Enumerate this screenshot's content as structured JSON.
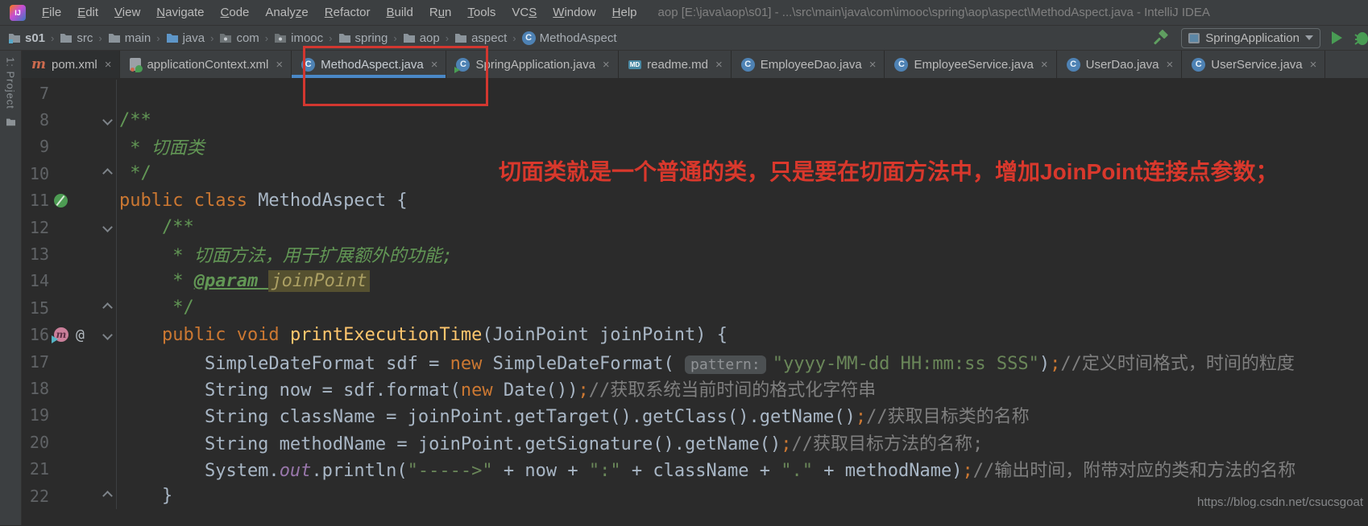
{
  "window": {
    "title": "aop [E:\\java\\aop\\s01] - ...\\src\\main\\java\\com\\imooc\\spring\\aop\\aspect\\MethodAspect.java - IntelliJ IDEA"
  },
  "logo_text": "IJ",
  "menu": {
    "items": [
      {
        "label": "File",
        "m": 0
      },
      {
        "label": "Edit",
        "m": 0
      },
      {
        "label": "View",
        "m": 0
      },
      {
        "label": "Navigate",
        "m": 0
      },
      {
        "label": "Code",
        "m": 0
      },
      {
        "label": "Analyze",
        "m": 5
      },
      {
        "label": "Refactor",
        "m": 0
      },
      {
        "label": "Build",
        "m": 0
      },
      {
        "label": "Run",
        "m": 1
      },
      {
        "label": "Tools",
        "m": 0
      },
      {
        "label": "VCS",
        "m": 2
      },
      {
        "label": "Window",
        "m": 0
      },
      {
        "label": "Help",
        "m": 0
      }
    ]
  },
  "breadcrumbs": [
    {
      "label": "s01",
      "icon": "module",
      "bold": true
    },
    {
      "label": "src",
      "icon": "folder"
    },
    {
      "label": "main",
      "icon": "folder"
    },
    {
      "label": "java",
      "icon": "source-folder"
    },
    {
      "label": "com",
      "icon": "package"
    },
    {
      "label": "imooc",
      "icon": "package"
    },
    {
      "label": "spring",
      "icon": "folder"
    },
    {
      "label": "aop",
      "icon": "folder"
    },
    {
      "label": "aspect",
      "icon": "folder"
    },
    {
      "label": "MethodAspect",
      "icon": "class"
    }
  ],
  "toolbar": {
    "run_config": "SpringApplication"
  },
  "project_strip": {
    "label": "1: Project"
  },
  "tabs": [
    {
      "label": "pom.xml",
      "icon": "maven",
      "state": "dim"
    },
    {
      "label": "applicationContext.xml",
      "icon": "springcfg",
      "state": ""
    },
    {
      "label": "MethodAspect.java",
      "icon": "class",
      "state": "selected"
    },
    {
      "label": "SpringApplication.java",
      "icon": "class-run",
      "state": ""
    },
    {
      "label": "readme.md",
      "icon": "md",
      "state": ""
    },
    {
      "label": "EmployeeDao.java",
      "icon": "class",
      "state": ""
    },
    {
      "label": "EmployeeService.java",
      "icon": "class",
      "state": ""
    },
    {
      "label": "UserDao.java",
      "icon": "class",
      "state": ""
    },
    {
      "label": "UserService.java",
      "icon": "class",
      "state": ""
    }
  ],
  "annotation": {
    "text": "切面类就是一个普通的类，只是要在切面方法中，增加JoinPoint连接点参数；"
  },
  "watermark": "https://blog.csdn.net/csucsgoat",
  "editor": {
    "lines": [
      {
        "n": 7,
        "gutter": [],
        "segs": []
      },
      {
        "n": 8,
        "gutter": [
          "fold-down"
        ],
        "segs": [
          {
            "t": "/**",
            "c": "doc"
          }
        ]
      },
      {
        "n": 9,
        "gutter": [],
        "segs": [
          {
            "t": " * ",
            "c": "doc"
          },
          {
            "t": "切面类",
            "c": "doc-i"
          }
        ]
      },
      {
        "n": 10,
        "gutter": [
          "fold-up"
        ],
        "segs": [
          {
            "t": " */",
            "c": "doc"
          }
        ]
      },
      {
        "n": 11,
        "gutter": [
          "bean"
        ],
        "segs": [
          {
            "t": "public class ",
            "c": "kw"
          },
          {
            "t": "MethodAspect {",
            "c": "plain"
          }
        ]
      },
      {
        "n": 12,
        "gutter": [
          "fold-down"
        ],
        "segs": [
          {
            "t": "    /**",
            "c": "doc"
          }
        ]
      },
      {
        "n": 13,
        "gutter": [],
        "segs": [
          {
            "t": "     * ",
            "c": "doc"
          },
          {
            "t": "切面方法，用于扩展额外的功能;",
            "c": "doc-i"
          }
        ]
      },
      {
        "n": 14,
        "gutter": [],
        "segs": [
          {
            "t": "     * ",
            "c": "doc"
          },
          {
            "t": "@param ",
            "c": "doc-tag"
          },
          {
            "t": "joinPoint",
            "c": "doc-hl"
          }
        ]
      },
      {
        "n": 15,
        "gutter": [
          "fold-up"
        ],
        "segs": [
          {
            "t": "     */",
            "c": "doc"
          }
        ]
      },
      {
        "n": 16,
        "gutter": [
          "method",
          "at",
          "fold-down"
        ],
        "segs": [
          {
            "t": "    ",
            "c": "plain"
          },
          {
            "t": "public void ",
            "c": "kw"
          },
          {
            "t": "printExecutionTime",
            "c": "fn"
          },
          {
            "t": "(JoinPoint joinPoint) {",
            "c": "plain"
          }
        ]
      },
      {
        "n": 17,
        "gutter": [],
        "segs": [
          {
            "t": "        SimpleDateFormat sdf = ",
            "c": "plain"
          },
          {
            "t": "new ",
            "c": "kw"
          },
          {
            "t": "SimpleDateFormat( ",
            "c": "plain"
          },
          {
            "t": "pattern:",
            "c": "hint"
          },
          {
            "t": "\"yyyy-MM-dd HH:mm:ss SSS\"",
            "c": "str"
          },
          {
            "t": ")",
            "c": "plain"
          },
          {
            "t": ";",
            "c": "kw"
          },
          {
            "t": "//定义时间格式，时间的粒度",
            "c": "cmt"
          }
        ]
      },
      {
        "n": 18,
        "gutter": [],
        "segs": [
          {
            "t": "        String now = sdf.format(",
            "c": "plain"
          },
          {
            "t": "new ",
            "c": "kw"
          },
          {
            "t": "Date())",
            "c": "plain"
          },
          {
            "t": ";",
            "c": "kw"
          },
          {
            "t": "//获取系统当前时间的格式化字符串",
            "c": "cmt"
          }
        ]
      },
      {
        "n": 19,
        "gutter": [],
        "segs": [
          {
            "t": "        String className = joinPoint.getTarget().getClass().getName()",
            "c": "plain"
          },
          {
            "t": ";",
            "c": "kw"
          },
          {
            "t": "//获取目标类的名称",
            "c": "cmt"
          }
        ]
      },
      {
        "n": 20,
        "gutter": [],
        "segs": [
          {
            "t": "        String methodName = joinPoint.getSignature().getName()",
            "c": "plain"
          },
          {
            "t": ";",
            "c": "kw"
          },
          {
            "t": "//获取目标方法的名称;",
            "c": "cmt"
          }
        ]
      },
      {
        "n": 21,
        "gutter": [],
        "segs": [
          {
            "t": "        System.",
            "c": "plain"
          },
          {
            "t": "out",
            "c": "field"
          },
          {
            "t": ".println(",
            "c": "plain"
          },
          {
            "t": "\"----->\"",
            "c": "str"
          },
          {
            "t": " + now + ",
            "c": "plain"
          },
          {
            "t": "\":\"",
            "c": "str"
          },
          {
            "t": " + className + ",
            "c": "plain"
          },
          {
            "t": "\".\"",
            "c": "str"
          },
          {
            "t": " + methodName)",
            "c": "plain"
          },
          {
            "t": ";",
            "c": "kw"
          },
          {
            "t": "//输出时间，附带对应的类和方法的名称",
            "c": "cmt"
          }
        ]
      },
      {
        "n": 22,
        "gutter": [
          "fold-up"
        ],
        "segs": [
          {
            "t": "    }",
            "c": "plain"
          }
        ]
      }
    ]
  }
}
